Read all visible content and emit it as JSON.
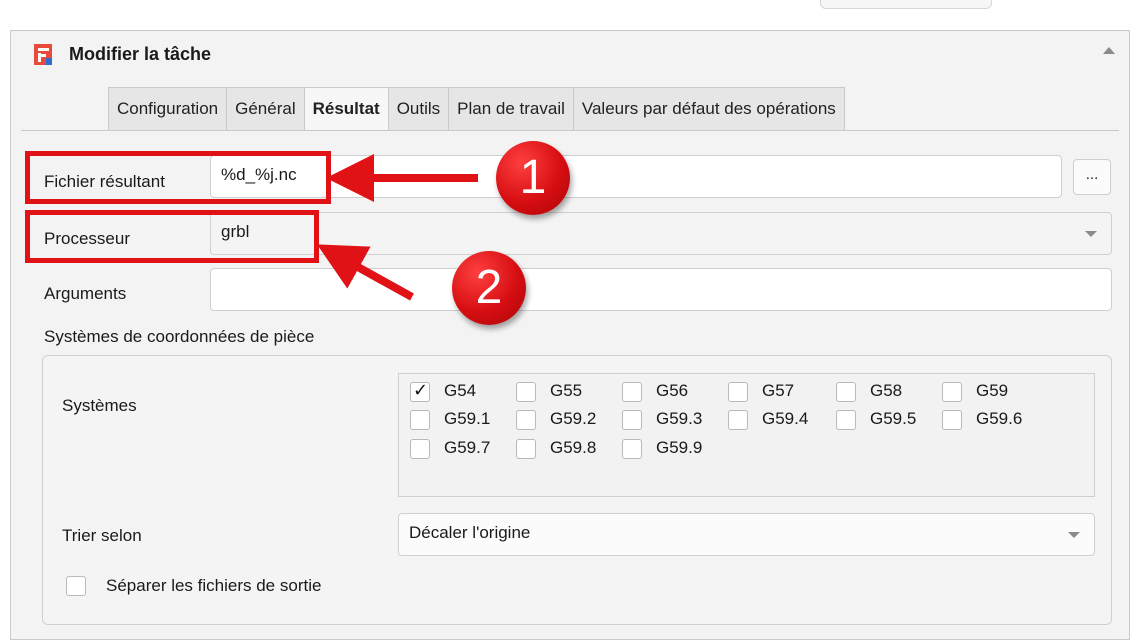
{
  "panel": {
    "title": "Modifier la tâche",
    "icon": "app-logo-icon"
  },
  "tabs": [
    {
      "label": "Configuration",
      "active": false
    },
    {
      "label": "Général",
      "active": false
    },
    {
      "label": "Résultat",
      "active": true
    },
    {
      "label": "Outils",
      "active": false
    },
    {
      "label": "Plan de travail",
      "active": false
    },
    {
      "label": "Valeurs par défaut des opérations",
      "active": false
    }
  ],
  "output": {
    "file_label": "Fichier résultant",
    "file_value": "%d_%j.nc",
    "browse_label": "...",
    "processor_label": "Processeur",
    "processor_value": "grbl",
    "arguments_label": "Arguments",
    "arguments_value": ""
  },
  "annotations": {
    "badge1": "1",
    "badge2": "2",
    "color": "#e01216"
  },
  "wcs": {
    "group_title": "Systèmes de coordonnées de pièce",
    "systems_label": "Systèmes",
    "systems": [
      {
        "label": "G54",
        "checked": true
      },
      {
        "label": "G55",
        "checked": false
      },
      {
        "label": "G56",
        "checked": false
      },
      {
        "label": "G57",
        "checked": false
      },
      {
        "label": "G58",
        "checked": false
      },
      {
        "label": "G59",
        "checked": false
      },
      {
        "label": "G59.1",
        "checked": false
      },
      {
        "label": "G59.2",
        "checked": false
      },
      {
        "label": "G59.3",
        "checked": false
      },
      {
        "label": "G59.4",
        "checked": false
      },
      {
        "label": "G59.5",
        "checked": false
      },
      {
        "label": "G59.6",
        "checked": false
      },
      {
        "label": "G59.7",
        "checked": false
      },
      {
        "label": "G59.8",
        "checked": false
      },
      {
        "label": "G59.9",
        "checked": false
      }
    ],
    "sort_label": "Trier selon",
    "sort_value": "Décaler l'origine",
    "split_label": "Séparer les fichiers de sortie",
    "split_checked": false
  }
}
